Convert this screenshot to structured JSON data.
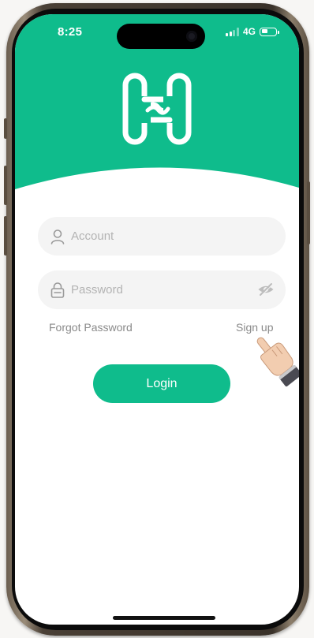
{
  "status_bar": {
    "time": "8:25",
    "network": "4G"
  },
  "colors": {
    "brand": "#0fbc8c",
    "field_bg": "#f4f4f4",
    "placeholder": "#b3b3b3",
    "link": "#8a8a8a"
  },
  "logo": {
    "icon": "brand-logo-icon"
  },
  "form": {
    "account": {
      "icon": "user-icon",
      "placeholder": "Account",
      "value": ""
    },
    "password": {
      "icon": "lock-icon",
      "placeholder": "Password",
      "value": "",
      "toggle_icon": "eye-hidden-icon"
    },
    "forgot_password": "Forgot Password",
    "sign_up": "Sign up",
    "login_label": "Login"
  },
  "overlay": {
    "pointer_icon": "pointing-hand-icon"
  }
}
